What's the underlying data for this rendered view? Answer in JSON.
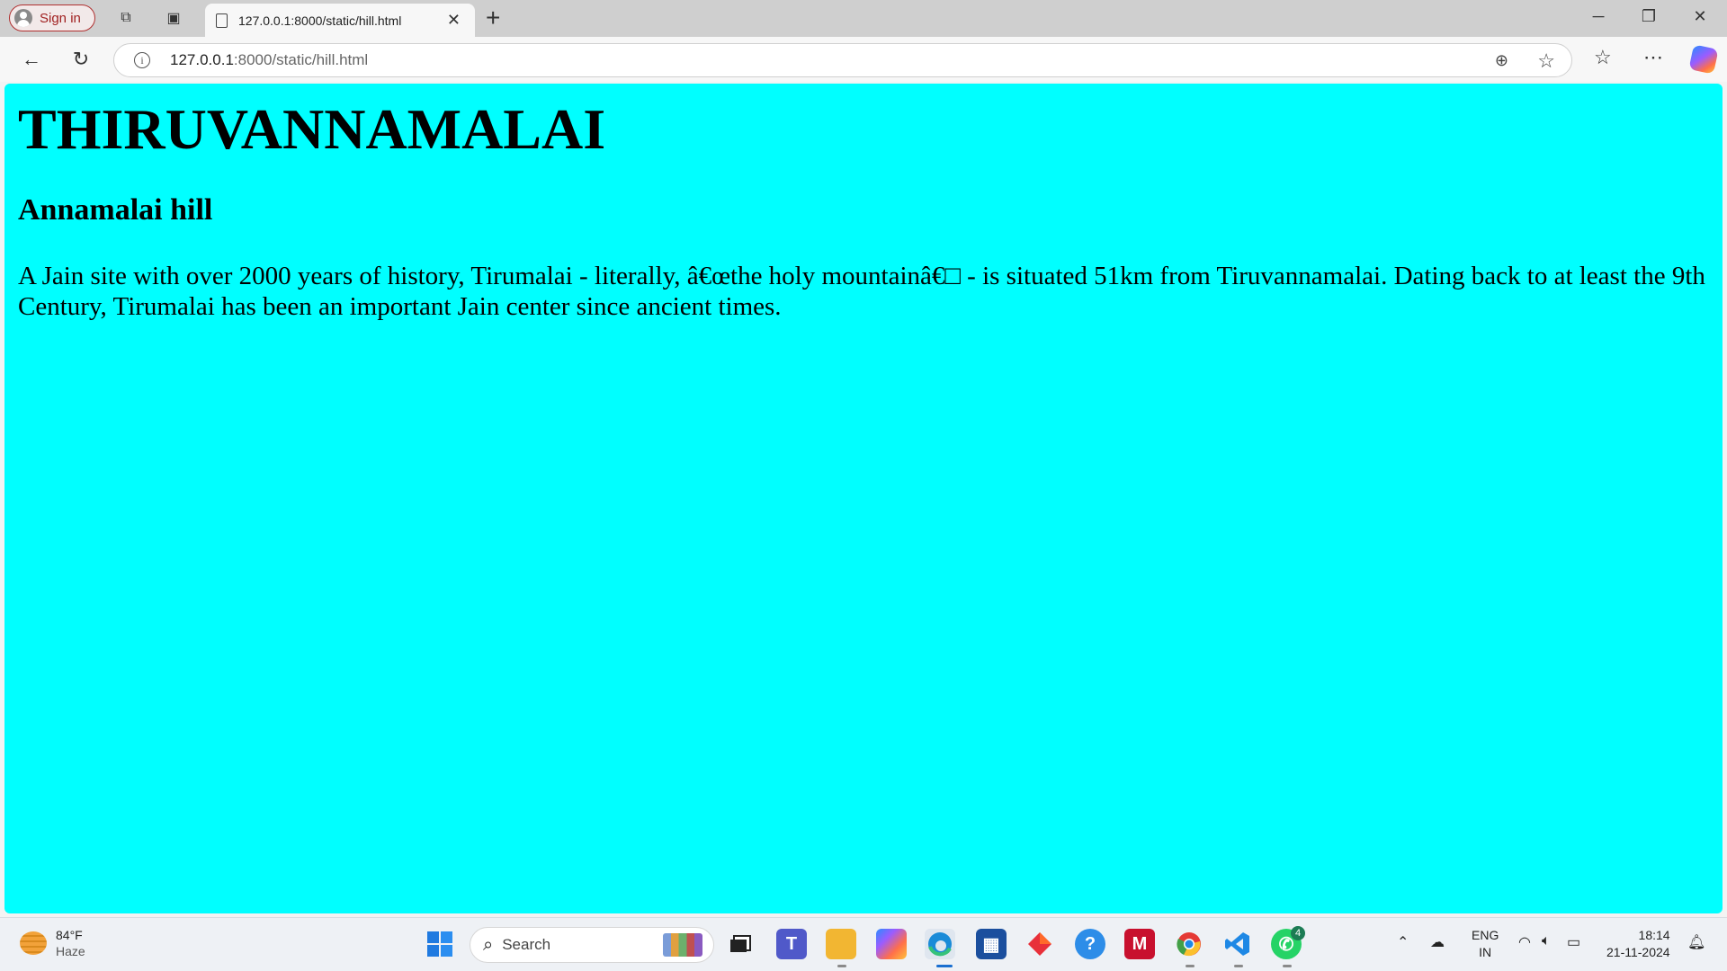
{
  "browser": {
    "signin_label": "Sign in",
    "tab_title": "127.0.0.1:8000/static/hill.html",
    "url_host": "127.0.0.1",
    "url_rest": ":8000/static/hill.html"
  },
  "page": {
    "heading": "THIRUVANNAMALAI",
    "subheading": "Annamalai hill",
    "paragraph": "A Jain site with over 2000 years of history, Tirumalai - literally, â€œthe holy mountainâ€□ - is situated 51km from Tiruvannamalai. Dating back to at least the 9th Century, Tirumalai has been an important Jain center since ancient times.",
    "background_color": "#00ffff"
  },
  "taskbar": {
    "weather_temp": "84°F",
    "weather_desc": "Haze",
    "search_label": "Search",
    "whatsapp_badge": "4",
    "lang_line1": "ENG",
    "lang_line2": "IN",
    "time": "18:14",
    "date": "21-11-2024"
  }
}
